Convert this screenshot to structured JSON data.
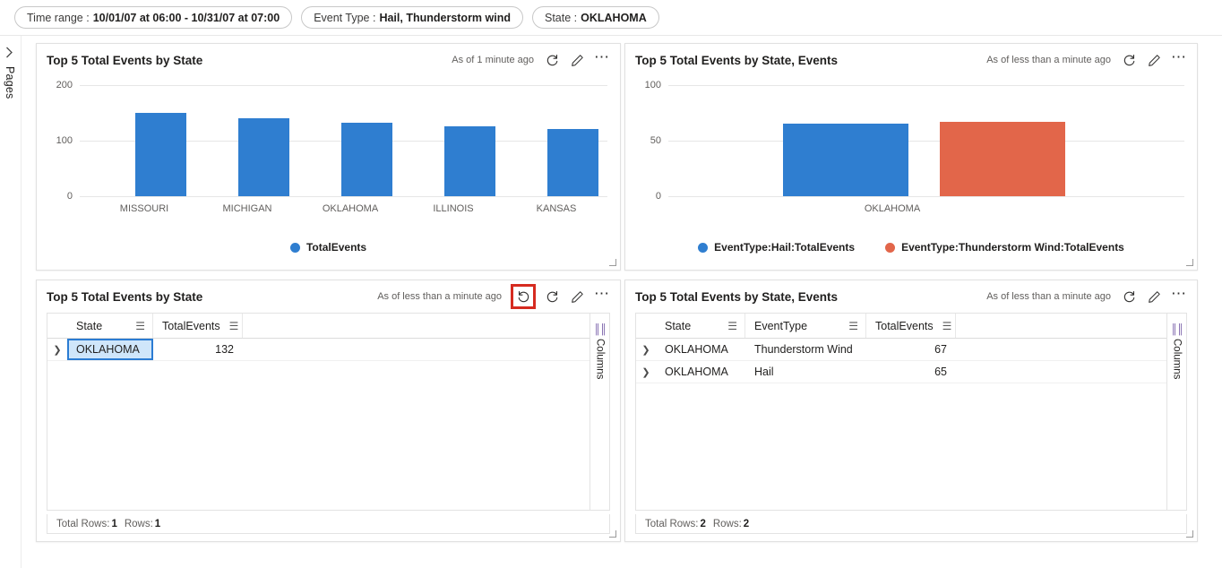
{
  "filters": [
    {
      "label": "Time range :",
      "value": "10/01/07 at 06:00 - 10/31/07 at 07:00",
      "name": "filter-time-range"
    },
    {
      "label": "Event Type :",
      "value": "Hail, Thunderstorm wind",
      "name": "filter-event-type"
    },
    {
      "label": "State :",
      "value": "OKLAHOMA",
      "name": "filter-state"
    }
  ],
  "rail": {
    "label": "Pages",
    "chevron": "chevron-right-icon"
  },
  "panels": {
    "top_left": {
      "title": "Top 5 Total Events by State",
      "as_of": "As of 1 minute ago"
    },
    "top_right": {
      "title": "Top 5 Total Events by State, Events",
      "as_of": "As of less than a minute ago"
    },
    "bottom_left": {
      "title": "Top 5 Total Events by State",
      "as_of": "As of less than a minute ago",
      "columns_tab": "Columns",
      "headers": [
        "State",
        "TotalEvents"
      ],
      "rows": [
        {
          "state": "OKLAHOMA",
          "total_events": "132"
        }
      ],
      "footer": {
        "total_rows_label": "Total Rows:",
        "total_rows": "1",
        "rows_label": "Rows:",
        "rows": "1"
      }
    },
    "bottom_right": {
      "title": "Top 5 Total Events by State, Events",
      "as_of": "As of less than a minute ago",
      "columns_tab": "Columns",
      "headers": [
        "State",
        "EventType",
        "TotalEvents"
      ],
      "rows": [
        {
          "state": "OKLAHOMA",
          "event_type": "Thunderstorm Wind",
          "total_events": "67"
        },
        {
          "state": "OKLAHOMA",
          "event_type": "Hail",
          "total_events": "65"
        }
      ],
      "footer": {
        "total_rows_label": "Total Rows:",
        "total_rows": "2",
        "rows_label": "Rows:",
        "rows": "2"
      }
    }
  },
  "colors": {
    "series_blue": "#2f7ed0",
    "series_orange": "#e2664a",
    "highlight_red": "#d62b20",
    "selection_blue": "#2b7cd3"
  },
  "chart_data": [
    {
      "type": "bar",
      "panel": "top_left",
      "title": "Top 5 Total Events by State",
      "categories": [
        "MISSOURI",
        "MICHIGAN",
        "OKLAHOMA",
        "ILLINOIS",
        "KANSAS"
      ],
      "values": [
        150,
        140,
        132,
        125,
        120
      ],
      "series": [
        {
          "name": "TotalEvents",
          "color": "#2f7ed0",
          "values": [
            150,
            140,
            132,
            125,
            120
          ]
        }
      ],
      "legend": [
        "TotalEvents"
      ],
      "legend_position": "bottom",
      "xlabel": "",
      "ylabel": "",
      "ylim": [
        0,
        200
      ],
      "yticks": [
        0,
        100,
        200
      ],
      "grid": true
    },
    {
      "type": "bar",
      "panel": "top_right",
      "title": "Top 5 Total Events by State, Events",
      "categories": [
        "OKLAHOMA"
      ],
      "series": [
        {
          "name": "EventType:Hail:TotalEvents",
          "color": "#2f7ed0",
          "values": [
            65
          ]
        },
        {
          "name": "EventType:Thunderstorm Wind:TotalEvents",
          "color": "#e2664a",
          "values": [
            67
          ]
        }
      ],
      "legend": [
        "EventType:Hail:TotalEvents",
        "EventType:Thunderstorm Wind:TotalEvents"
      ],
      "legend_position": "bottom",
      "xlabel": "",
      "ylabel": "",
      "ylim": [
        0,
        100
      ],
      "yticks": [
        0,
        50,
        100
      ],
      "grid": true
    }
  ]
}
